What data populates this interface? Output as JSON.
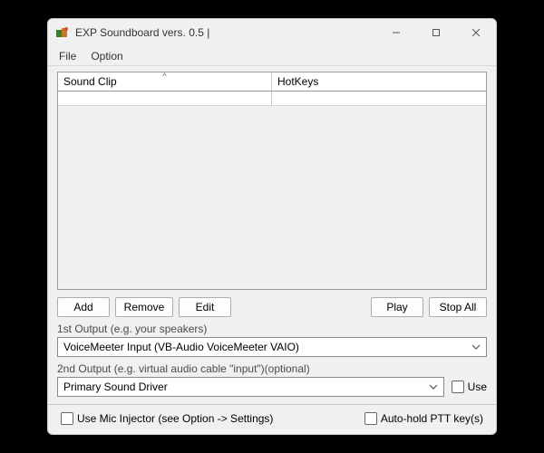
{
  "window": {
    "title": "EXP Soundboard vers. 0.5 |"
  },
  "menu": {
    "file": "File",
    "option": "Option"
  },
  "table": {
    "col_sound": "Sound Clip",
    "col_hotkeys": "HotKeys"
  },
  "buttons": {
    "add": "Add",
    "remove": "Remove",
    "edit": "Edit",
    "play": "Play",
    "stopall": "Stop All"
  },
  "output1": {
    "label": "1st Output (e.g. your speakers)",
    "value": "VoiceMeeter Input (VB-Audio VoiceMeeter VAIO)"
  },
  "output2": {
    "label": "2nd Output (e.g. virtual audio cable \"input\")(optional)",
    "value": "Primary Sound Driver",
    "use_label": "Use"
  },
  "footer": {
    "mic_injector": "Use Mic Injector (see Option -> Settings)",
    "autohold": "Auto-hold PTT key(s)"
  }
}
